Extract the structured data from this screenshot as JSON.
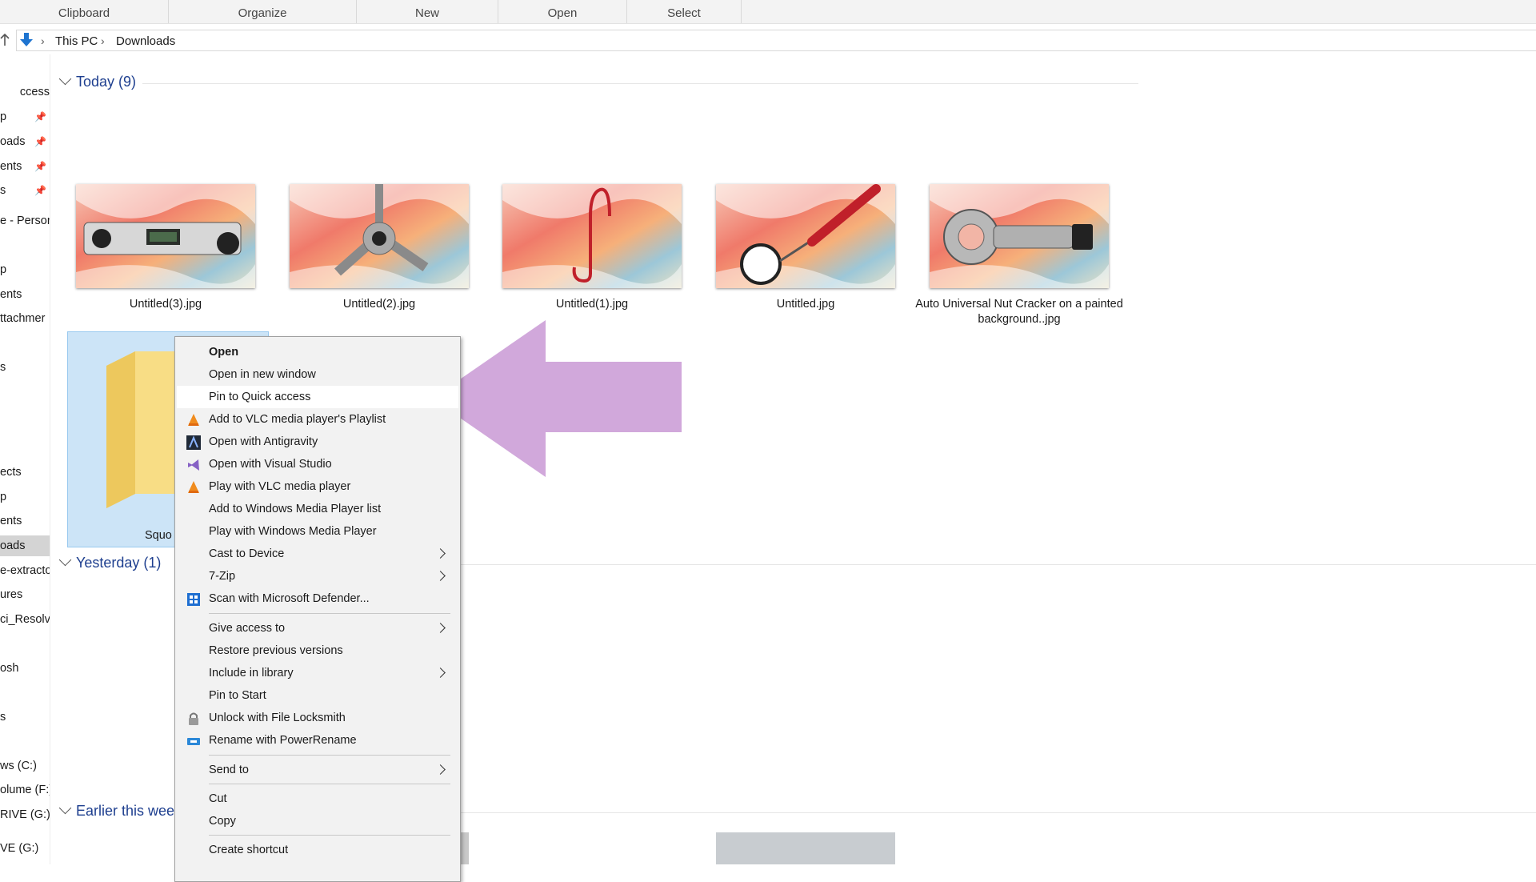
{
  "ribbon": {
    "groups": [
      "Clipboard",
      "Organize",
      "New",
      "Open",
      "Select"
    ]
  },
  "address": {
    "crumbs": [
      "This PC",
      "Downloads"
    ]
  },
  "nav": {
    "items": [
      "ccess",
      "p",
      "oads",
      "ents",
      "s",
      "e - Person",
      "p",
      "ents",
      "ttachmer",
      "s",
      "ects",
      "p",
      "ents",
      "oads",
      "e-extracto",
      "ures",
      "ci_Resolv",
      "osh",
      "s",
      "ws (C:)",
      "olume (F:)",
      "RIVE (G:)",
      "VE (G:)"
    ],
    "selected_item": "oads"
  },
  "groups": {
    "today": "Today (9)",
    "yesterday": "Yesterday (1)",
    "earlier": "Earlier this week"
  },
  "files": [
    {
      "name": "Untitled(3).jpg",
      "subject": "digital level"
    },
    {
      "name": "Untitled(2).jpg",
      "subject": "three-prong wrench"
    },
    {
      "name": "Untitled(1).jpg",
      "subject": "red S-hook"
    },
    {
      "name": "Untitled.jpg",
      "subject": "inspection mirror"
    },
    {
      "name": "Auto Universal Nut Cracker on a painted background..jpg",
      "subject": "nut splitter"
    }
  ],
  "folder": {
    "name": "Squo"
  },
  "context_menu": {
    "items": [
      {
        "label": "Open",
        "bold": true
      },
      {
        "label": "Open in new window"
      },
      {
        "label": "Pin to Quick access",
        "highlighted": true
      },
      {
        "label": "Add to VLC media player's Playlist",
        "icon": "vlc-icon"
      },
      {
        "label": "Open with Antigravity",
        "icon": "antigravity-icon"
      },
      {
        "label": "Open with Visual Studio",
        "icon": "visual-studio-icon"
      },
      {
        "label": "Play with VLC media player",
        "icon": "vlc-icon"
      },
      {
        "label": "Add to Windows Media Player list"
      },
      {
        "label": "Play with Windows Media Player"
      },
      {
        "label": "Cast to Device",
        "submenu": true
      },
      {
        "label": "7-Zip",
        "submenu": true
      },
      {
        "label": "Scan with Microsoft Defender...",
        "icon": "defender-icon"
      },
      {
        "label": "Give access to",
        "submenu": true
      },
      {
        "label": "Restore previous versions"
      },
      {
        "label": "Include in library",
        "submenu": true
      },
      {
        "label": "Pin to Start"
      },
      {
        "label": "Unlock with File Locksmith",
        "icon": "lock-icon"
      },
      {
        "label": "Rename with PowerRename",
        "icon": "powerrename-icon"
      },
      {
        "label": "Send to",
        "submenu": true
      },
      {
        "label": "Cut"
      },
      {
        "label": "Copy"
      },
      {
        "label": "Create shortcut"
      }
    ]
  },
  "colors": {
    "arrow": "#d1a8db",
    "accent": "#1e3f8f",
    "selection": "#cce4f7"
  }
}
